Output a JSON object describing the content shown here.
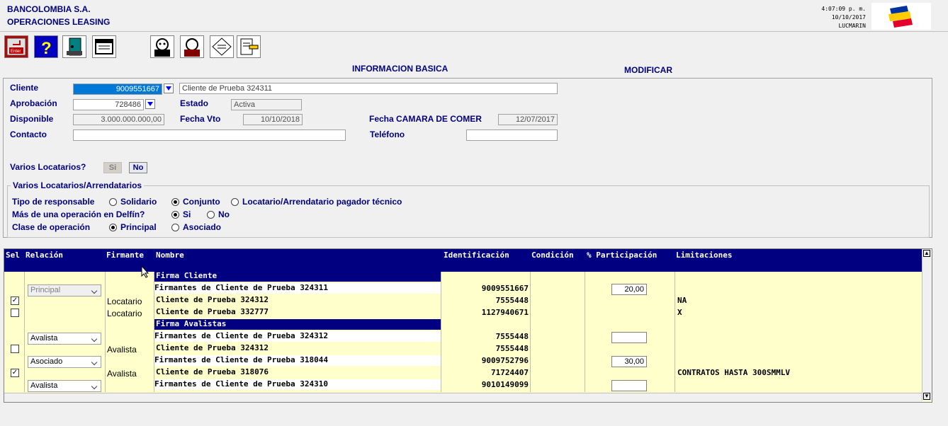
{
  "header": {
    "company": "BANCOLOMBIA S.A.",
    "module": "OPERACIONES LEASING",
    "time": "4:07:09 p. m.",
    "date": "10/10/2017",
    "user": "LUCMARIN"
  },
  "toolbar": {
    "icons": [
      "enter-icon",
      "help-icon",
      "exit-door-icon",
      "window-icon",
      "person-icon",
      "person-alt-icon",
      "document-stamp-icon",
      "document-edit-icon"
    ],
    "enter_label": "Enter"
  },
  "section": {
    "title": "INFORMACION BASICA",
    "mode": "MODIFICAR"
  },
  "form": {
    "cliente_label": "Cliente",
    "cliente_id": "9009551667",
    "cliente_nombre": "Cliente de Prueba 324311",
    "aprobacion_label": "Aprobación",
    "aprobacion_value": "728486",
    "estado_label": "Estado",
    "estado_value": "Activa",
    "disponible_label": "Disponible",
    "disponible_value": "3.000.000.000,00",
    "fecha_vto_label": "Fecha Vto",
    "fecha_vto_value": "10/10/2018",
    "fecha_camara_label": "Fecha CAMARA DE COMER",
    "fecha_camara_value": "12/07/2017",
    "contacto_label": "Contacto",
    "contacto_value": "",
    "telefono_label": "Teléfono",
    "telefono_value": "",
    "varios_label": "Varios Locatarios?",
    "si_label": "Si",
    "no_label": "No"
  },
  "group": {
    "title": "Varios Locatarios/Arrendatarios",
    "tipo_label": "Tipo de responsable",
    "tipo_options": [
      "Solidario",
      "Conjunto",
      "Locatario/Arrendatario pagador técnico"
    ],
    "tipo_selected": "Conjunto",
    "mas_label": "Más de una operación en Delfín?",
    "mas_options": [
      "Si",
      "No"
    ],
    "mas_selected": "Si",
    "clase_label": "Clase de operación",
    "clase_options": [
      "Principal",
      "Asociado"
    ],
    "clase_selected": "Principal"
  },
  "grid": {
    "columns": [
      "Sel",
      "Relación",
      "Firmante",
      "Nombre",
      "Identificación",
      "Condición",
      "% Participación",
      "Limitaciones"
    ],
    "group_cliente": "Firma Cliente",
    "group_avalistas": "Firma Avalistas",
    "rows": [
      {
        "relacion": "Principal",
        "firmante": "",
        "nombre": "Firmantes de Cliente de Prueba 324311",
        "id": "9009551667",
        "participacion": "20,00",
        "limitaciones": "",
        "checked": false,
        "has_checkbox": false
      },
      {
        "relacion": "",
        "firmante": "Locatario",
        "nombre": "Cliente de Prueba 324312",
        "id": "7555448",
        "participacion": "",
        "limitaciones": "NA",
        "checked": true,
        "has_checkbox": true
      },
      {
        "relacion": "",
        "firmante": "Locatario",
        "nombre": "Cliente de Prueba 332777",
        "id": "1127940671",
        "participacion": "",
        "limitaciones": "X",
        "checked": false,
        "has_checkbox": true
      },
      {
        "relacion": "Avalista",
        "firmante": "",
        "nombre": "Firmantes de Cliente de Prueba 324312",
        "id": "7555448",
        "participacion": "",
        "limitaciones": "",
        "checked": false,
        "has_checkbox": false
      },
      {
        "relacion": "",
        "firmante": "Avalista",
        "nombre": "Cliente de Prueba 324312",
        "id": "7555448",
        "participacion": "",
        "limitaciones": "",
        "checked": false,
        "has_checkbox": true
      },
      {
        "relacion": "Asociado",
        "firmante": "",
        "nombre": "Firmantes de Cliente de Prueba 318044",
        "id": "9009752796",
        "participacion": "30,00",
        "limitaciones": "",
        "checked": false,
        "has_checkbox": false
      },
      {
        "relacion": "",
        "firmante": "Avalista",
        "nombre": "Cliente de Prueba 318076",
        "id": "71724407",
        "participacion": "",
        "limitaciones": "CONTRATOS HASTA 300SMMLV",
        "checked": true,
        "has_checkbox": true
      },
      {
        "relacion": "Avalista",
        "firmante": "",
        "nombre": "Firmantes de Cliente de Prueba 324310",
        "id": "9010149099",
        "participacion": "",
        "limitaciones": "",
        "checked": false,
        "has_checkbox": false
      }
    ]
  },
  "colors": {
    "navy": "#000080",
    "grid_bg": "#ffffcc",
    "selection": "#0078d7"
  }
}
